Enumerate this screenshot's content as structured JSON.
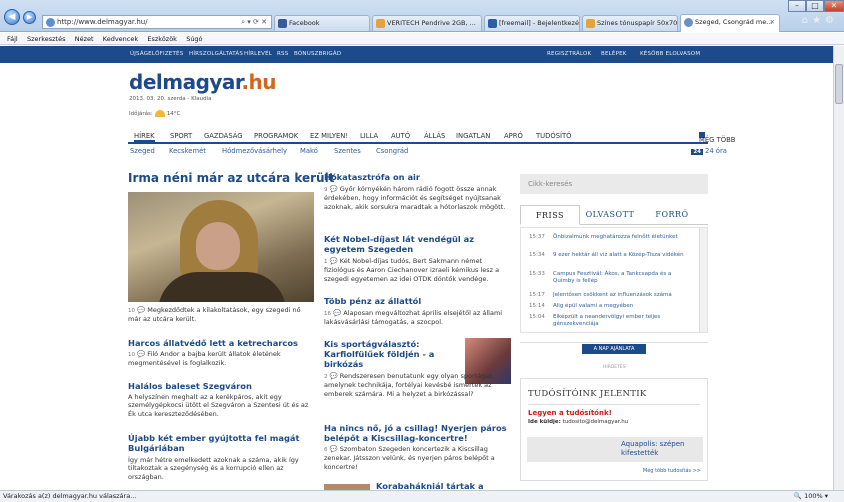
{
  "browser": {
    "url": "http://www.delmagyar.hu/",
    "url_controls": "⌕ ▾ ⟳ ✕",
    "tabs": [
      {
        "title": "Facebook",
        "color": "#3b5998"
      },
      {
        "title": "VERITECH Pendrive 2GB, ...",
        "color": "#e2a43b"
      },
      {
        "title": "[freemail] - Bejelentkezés...",
        "color": "#2a5ea8"
      },
      {
        "title": "Színes tónuspapír 50x70 c...",
        "color": "#e2a43b"
      },
      {
        "title": "Szeged, Csongrád me...",
        "color": "#6b8fc7",
        "active": true
      }
    ],
    "menu": [
      "Fájl",
      "Szerkesztés",
      "Nézet",
      "Kedvencek",
      "Eszközök",
      "Súgó"
    ],
    "status": "Várakozás a(z) delmagyar.hu válaszára...",
    "zoom": "100%",
    "zoom_icon": "search-icon"
  },
  "site": {
    "topbar_left": [
      "ÚJSÁGELŐFIZETÉS",
      "HÍRSZOLGÁLTATÁS",
      "HÍRLEVÉL",
      "RSS",
      "BÓNUSZBRIGÁD"
    ],
    "topbar_right": [
      "REGISZTRÁLOK",
      "BELÉPEK",
      "KÉSŐBB ELOLVASOM"
    ],
    "logo_main": "delmagyar",
    "logo_tld": ".hu",
    "date": "2013. 03. 20. szerda - Klaudia",
    "weather_label": "Időjárás:",
    "weather_temp": "14°C",
    "nav": [
      "HÍREK",
      "SPORT",
      "GAZDASÁG",
      "PROGRAMOK",
      "EZ MILYEN!",
      "LILLA",
      "AUTÓ",
      "ÁLLÁS",
      "INGATLAN",
      "APRÓ",
      "TUDÓSÍTÓ"
    ],
    "nav_more": "MÉG TÖBB",
    "subnav": [
      "Szeged",
      "Kecskemét",
      "Hódmezővásárhely",
      "Makó",
      "Szentes",
      "Csongrád"
    ],
    "h24_badge": "24",
    "h24_label": "24 óra"
  },
  "left": {
    "lead_title": "Irma néni már az utcára került",
    "lead_count": "10",
    "lead_text": "Megkezdődtek a kilakoltatások, egy szegedi nő már az utcára került.",
    "a2_title": "Harcos állatvédő lett a ketrecharcos",
    "a2_count": "10",
    "a2_text": "Filó Andor a bajba került állatok életének megmentésével is foglalkozik.",
    "a3_title": "Halálos baleset Szegváron",
    "a3_text": "A helyszínen meghalt az a kerékpáros, akit egy személygépkocsi ütött el Szegváron a Szentesi út és az Ék utca kereszteződésében.",
    "a4_title": "Újabb két ember gyújtotta fel magát Bulgáriában",
    "a4_text": "Így már hétre emelkedett azoknak a száma, akik így tiltakoztak a szegénység és a korrupció ellen az országban."
  },
  "middle": {
    "m1_title": "Hókatasztrófa on air",
    "m1_count": "9",
    "m1_text": "Győr környékén három rádió fogott össze annak érdekében, hogy információt és segítséget nyújtsanak azoknak, akik sorsukra maradtak a hótorlaszok mögött.",
    "m2_title": "Két Nobel-díjast lát vendégül az egyetem Szegeden",
    "m2_count": "1",
    "m2_text": "Két Nobel-díjas tudós, Bert Sakmann német fiziológus és Aaron Ciechanover izraeli kémikus lesz a szegedi egyetemen az idei OTDK döntők vendége.",
    "m3_title": "Több pénz az állattól",
    "m3_count": "16",
    "m3_text": "Alaposan megváltozhat április elsejétől az állami lakásvásárlási támogatás, a szocpol.",
    "m4_title": "Kis sportágválasztó: Karfiolfülűek földjén - a birkózás",
    "m4_count": "2",
    "m4_text": "Rendszeresen benutatunk egy olyan sportágat, amelynek technikája, fortélyai kevésbé ismertek az emberek számára. Mi a helyzet a birkózással?",
    "m5_title": "Ha nincs nő, jó a csillag! Nyerjen páros belépőt a Kiscsillag-koncertre!",
    "m5_count": "6",
    "m5_text": "Szombaton Szegeden koncertezik a Kiscsillag zenekar. Játsszon velünk, és nyerjen páros belépőt a koncertre!",
    "m6_title": "Korabahákniál tártak a"
  },
  "right": {
    "search_placeholder": "Cikk-keresés",
    "tabs": [
      "FRISS",
      "OLVASOTT",
      "FORRÓ"
    ],
    "feed": [
      {
        "time": "15:37",
        "text": "Önbizalmunk meghatározza felnőtt életünket"
      },
      {
        "time": "15:34",
        "text": "9 ezer hektár áll víz alatt a Közép-Tisza vidékén"
      },
      {
        "time": "15:33",
        "text": "Campus Fesztivál: Ákos, a Tankcsapda és a Quimby is fellép"
      },
      {
        "time": "15:17",
        "text": "Jelentősen csökkent az influenzások száma"
      },
      {
        "time": "15:14",
        "text": "Alig épül valami a megyében"
      },
      {
        "time": "15:04",
        "text": "Elképzült a neandervölgyi ember teljes génszekvenciája"
      }
    ],
    "naplo": "A NAP AJÁNLATA",
    "hirdetes": "HIRDETÉS",
    "tud_title": "TUDÓSÍTÓINK JELENTIK",
    "tud_red": "Legyen a tudósítónk!",
    "tud_mail_label": "Ide küldje:",
    "tud_mail": "tudosito@delmagyar.hu",
    "aqua": "Aquapolis: szépen kifestették",
    "more_tud": "Még több tudósítás >>"
  }
}
